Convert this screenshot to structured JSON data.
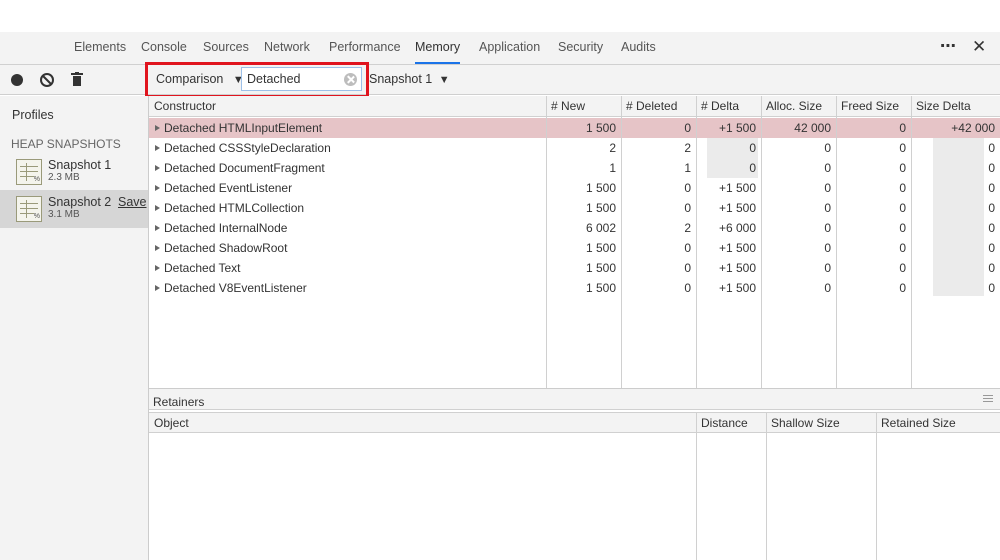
{
  "devtools_tabs": [
    {
      "label": "Elements",
      "active": false
    },
    {
      "label": "Console",
      "active": false
    },
    {
      "label": "Sources",
      "active": false
    },
    {
      "label": "Network",
      "active": false
    },
    {
      "label": "Performance",
      "active": false
    },
    {
      "label": "Memory",
      "active": true
    },
    {
      "label": "Application",
      "active": false
    },
    {
      "label": "Security",
      "active": false
    },
    {
      "label": "Audits",
      "active": false
    }
  ],
  "toolbar": {
    "view_mode": "Comparison",
    "view_mode_caret": "▼",
    "filter_value": "Detached",
    "baseline_snapshot": "Snapshot 1",
    "baseline_caret": "▼"
  },
  "sidebar": {
    "profiles_label": "Profiles",
    "section_label": "HEAP SNAPSHOTS",
    "snapshots": [
      {
        "name": "Snapshot 1",
        "size": "2.3 MB",
        "selected": false,
        "save_label": ""
      },
      {
        "name": "Snapshot 2",
        "size": "3.1 MB",
        "selected": true,
        "save_label": "Save"
      }
    ],
    "icon_pct": "%"
  },
  "grid": {
    "columns": [
      "Constructor",
      "# New",
      "# Deleted",
      "# Delta",
      "Alloc. Size",
      "Freed Size",
      "Size Delta"
    ],
    "rows": [
      {
        "constructor": "Detached HTMLInputElement",
        "new": "1 500",
        "deleted": "0",
        "delta": "+1 500",
        "alloc": "42 000",
        "freed": "0",
        "size_delta": "+42 000",
        "selected": true
      },
      {
        "constructor": "Detached CSSStyleDeclaration",
        "new": "2",
        "deleted": "2",
        "delta": "0",
        "alloc": "0",
        "freed": "0",
        "size_delta": "0",
        "selected": false
      },
      {
        "constructor": "Detached DocumentFragment",
        "new": "1",
        "deleted": "1",
        "delta": "0",
        "alloc": "0",
        "freed": "0",
        "size_delta": "0",
        "selected": false
      },
      {
        "constructor": "Detached EventListener",
        "new": "1 500",
        "deleted": "0",
        "delta": "+1 500",
        "alloc": "0",
        "freed": "0",
        "size_delta": "0",
        "selected": false
      },
      {
        "constructor": "Detached HTMLCollection",
        "new": "1 500",
        "deleted": "0",
        "delta": "+1 500",
        "alloc": "0",
        "freed": "0",
        "size_delta": "0",
        "selected": false
      },
      {
        "constructor": "Detached InternalNode",
        "new": "6 002",
        "deleted": "2",
        "delta": "+6 000",
        "alloc": "0",
        "freed": "0",
        "size_delta": "0",
        "selected": false
      },
      {
        "constructor": "Detached ShadowRoot",
        "new": "1 500",
        "deleted": "0",
        "delta": "+1 500",
        "alloc": "0",
        "freed": "0",
        "size_delta": "0",
        "selected": false
      },
      {
        "constructor": "Detached Text",
        "new": "1 500",
        "deleted": "0",
        "delta": "+1 500",
        "alloc": "0",
        "freed": "0",
        "size_delta": "0",
        "selected": false
      },
      {
        "constructor": "Detached V8EventListener",
        "new": "1 500",
        "deleted": "0",
        "delta": "+1 500",
        "alloc": "0",
        "freed": "0",
        "size_delta": "0",
        "selected": false
      }
    ]
  },
  "retainers": {
    "title": "Retainers",
    "columns": [
      "Object",
      "Distance",
      "Shallow Size",
      "Retained Size"
    ]
  },
  "colors": {
    "selected_row": "#e6c4c7",
    "highlight_border": "#e0141e",
    "active_tab_underline": "#1a73e8"
  }
}
